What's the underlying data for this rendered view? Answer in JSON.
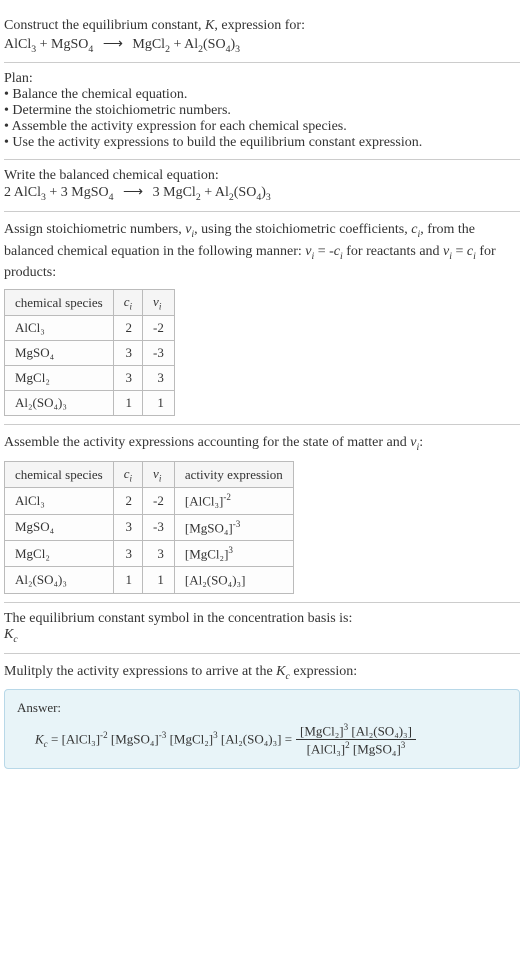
{
  "intro": {
    "line1": "Construct the equilibrium constant, ",
    "K": "K",
    "line1b": ", expression for:",
    "eq_left1": "AlCl",
    "eq_left1_sub": "3",
    "plus": " + ",
    "eq_left2": "MgSO",
    "eq_left2_sub": "4",
    "arrow": "⟶",
    "eq_right1": "MgCl",
    "eq_right1_sub": "2",
    "eq_right2": "Al",
    "eq_right2_sub1": "2",
    "eq_right2_mid": "(SO",
    "eq_right2_sub2": "4",
    "eq_right2_end": ")",
    "eq_right2_sub3": "3"
  },
  "plan": {
    "title": "Plan:",
    "items": [
      "Balance the chemical equation.",
      "Determine the stoichiometric numbers.",
      "Assemble the activity expression for each chemical species.",
      "Use the activity expressions to build the equilibrium constant expression."
    ]
  },
  "balanced": {
    "title": "Write the balanced chemical equation:",
    "c1": "2 AlCl",
    "c1_sub": "3",
    "c2": "3 MgSO",
    "c2_sub": "4",
    "c3": "3 MgCl",
    "c3_sub": "2",
    "c4a": "Al",
    "c4a_sub": "2",
    "c4b": "(SO",
    "c4b_sub": "4",
    "c4c": ")",
    "c4c_sub": "3"
  },
  "assign": {
    "text1": "Assign stoichiometric numbers, ",
    "nu": "ν",
    "i": "i",
    "text2": ", using the stoichiometric coefficients, ",
    "c": "c",
    "text3": ", from the balanced chemical equation in the following manner: ",
    "eq1": " = -",
    "text4": " for reactants and ",
    "eq2": " = ",
    "text5": " for products:"
  },
  "table1": {
    "headers": [
      "chemical species",
      "cᵢ",
      "νᵢ"
    ],
    "rows": [
      {
        "species": "AlCl₃",
        "c": "2",
        "nu": "-2"
      },
      {
        "species": "MgSO₄",
        "c": "3",
        "nu": "-3"
      },
      {
        "species": "MgCl₂",
        "c": "3",
        "nu": "3"
      },
      {
        "species": "Al₂(SO₄)₃",
        "c": "1",
        "nu": "1"
      }
    ]
  },
  "assemble": {
    "text": "Assemble the activity expressions accounting for the state of matter and ",
    "nu": "ν",
    "i": "i",
    "colon": ":"
  },
  "table2": {
    "headers": [
      "chemical species",
      "cᵢ",
      "νᵢ",
      "activity expression"
    ],
    "rows": [
      {
        "species": "AlCl₃",
        "c": "2",
        "nu": "-2",
        "act_base": "[AlCl₃]",
        "act_exp": "-2"
      },
      {
        "species": "MgSO₄",
        "c": "3",
        "nu": "-3",
        "act_base": "[MgSO₄]",
        "act_exp": "-3"
      },
      {
        "species": "MgCl₂",
        "c": "3",
        "nu": "3",
        "act_base": "[MgCl₂]",
        "act_exp": "3"
      },
      {
        "species": "Al₂(SO₄)₃",
        "c": "1",
        "nu": "1",
        "act_base": "[Al₂(SO₄)₃]",
        "act_exp": ""
      }
    ]
  },
  "symbol": {
    "text": "The equilibrium constant symbol in the concentration basis is:",
    "K": "K",
    "c": "c"
  },
  "multiply": {
    "text1": "Mulitply the activity expressions to arrive at the ",
    "K": "K",
    "c": "c",
    "text2": " expression:"
  },
  "answer": {
    "label": "Answer:",
    "K": "K",
    "c": "c",
    "eq": " = ",
    "t1": "[AlCl₃]",
    "e1": "-2",
    "t2": " [MgSO₄]",
    "e2": "-3",
    "t3": " [MgCl₂]",
    "e3": "3",
    "t4": " [Al₂(SO₄)₃] = ",
    "frac_top1": "[MgCl₂]",
    "frac_top1_e": "3",
    "frac_top2": " [Al₂(SO₄)₃]",
    "frac_bot1": "[AlCl₃]",
    "frac_bot1_e": "2",
    "frac_bot2": " [MgSO₄]",
    "frac_bot2_e": "3"
  }
}
